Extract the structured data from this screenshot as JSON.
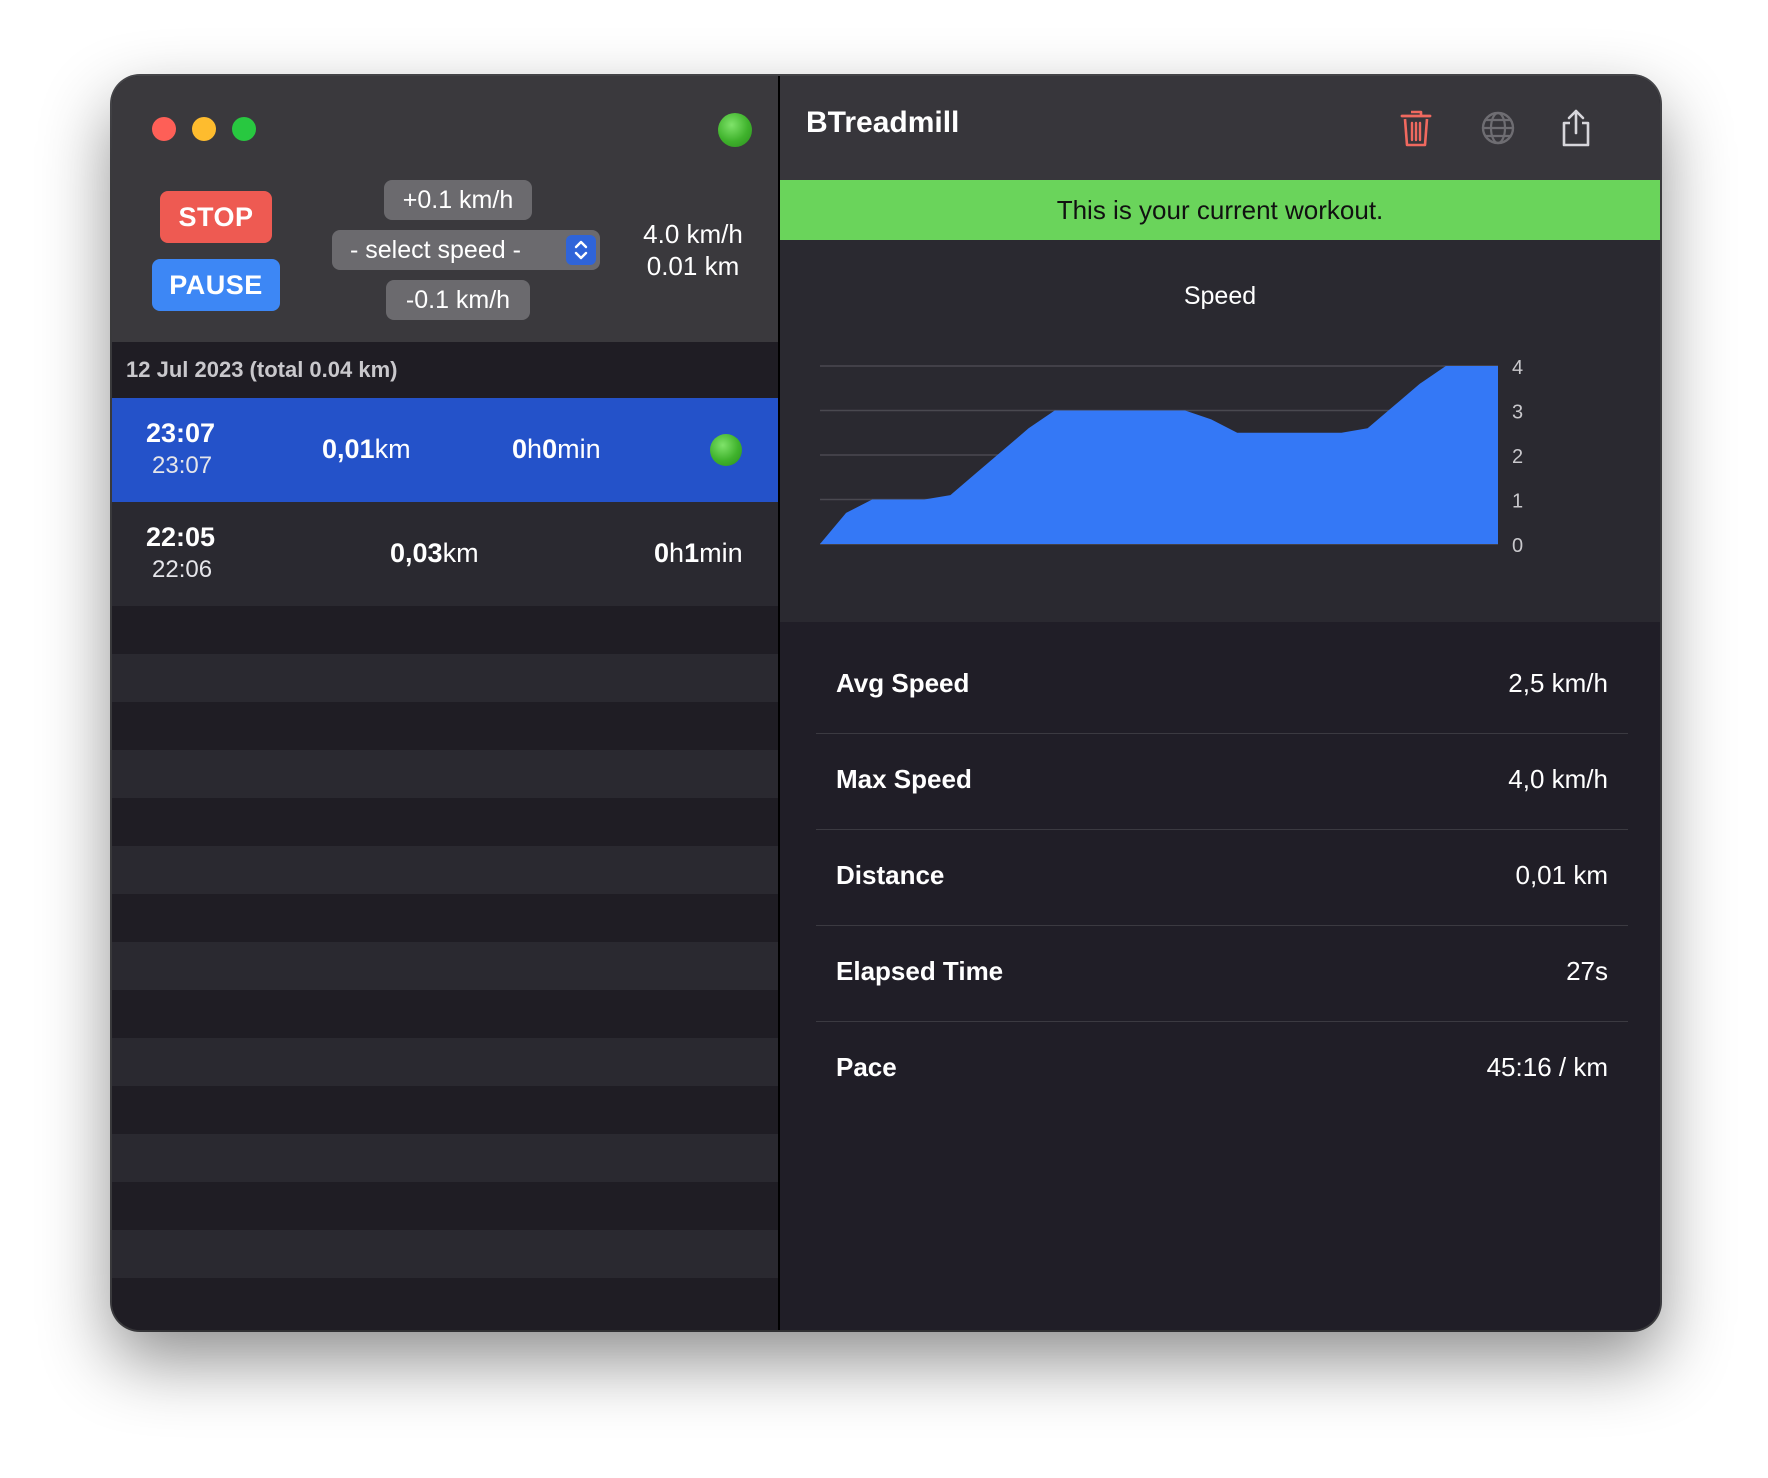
{
  "app": {
    "title": "BTreadmill"
  },
  "controls": {
    "stop_label": "STOP",
    "pause_label": "PAUSE",
    "speed_up_label": "+0.1 km/h",
    "speed_select_label": "- select speed -",
    "speed_down_label": "-0.1 km/h",
    "current_speed": "4.0 km/h",
    "current_distance": "0.01 km"
  },
  "history": {
    "day_header": "12 Jul 2023 (total 0.04 km)",
    "workouts": [
      {
        "start": "23:07",
        "end": "23:07",
        "dist_value": "0,01",
        "dist_unit": "km",
        "dur_h": "0",
        "dur_h_unit": "h",
        "dur_m": "0",
        "dur_m_unit": "min",
        "active": true
      },
      {
        "start": "22:05",
        "end": "22:06",
        "dist_value": "0,03",
        "dist_unit": "km",
        "dur_h": "0",
        "dur_h_unit": "h",
        "dur_m": "1",
        "dur_m_unit": "min",
        "active": false
      }
    ]
  },
  "detail": {
    "banner": "This is your current workout.",
    "stats": [
      {
        "label": "Avg Speed",
        "value": "2,5 km/h"
      },
      {
        "label": "Max Speed",
        "value": "4,0 km/h"
      },
      {
        "label": "Distance",
        "value": "0,01 km"
      },
      {
        "label": "Elapsed Time",
        "value": "27s"
      },
      {
        "label": "Pace",
        "value": "45:16 / km"
      }
    ]
  },
  "icons": {
    "delete": "trash-icon",
    "web": "globe-icon",
    "share": "share-icon"
  },
  "colors": {
    "stop": "#ee5a52",
    "pause": "#3d87f5",
    "selected_row": "#2452c9",
    "banner": "#6ad45b",
    "chart_fill": "#3478f6"
  },
  "chart_data": {
    "type": "area",
    "title": "Speed",
    "xlabel": "",
    "ylabel": "",
    "ylim": [
      0,
      4
    ],
    "y_ticks": [
      "0",
      "1",
      "2",
      "3",
      "4"
    ],
    "grid": true,
    "y_axis_position": "right",
    "x": [
      0,
      1,
      2,
      3,
      4,
      5,
      6,
      7,
      8,
      9,
      10,
      11,
      12,
      13,
      14,
      15,
      16,
      17,
      18,
      19,
      20,
      21,
      22,
      23,
      24,
      25,
      26
    ],
    "values": [
      0,
      0.7,
      1.0,
      1.0,
      1.0,
      1.1,
      1.6,
      2.1,
      2.6,
      3.0,
      3.0,
      3.0,
      3.0,
      3.0,
      3.0,
      2.8,
      2.5,
      2.5,
      2.5,
      2.5,
      2.5,
      2.6,
      3.1,
      3.6,
      4.0,
      4.0,
      4.0
    ]
  }
}
